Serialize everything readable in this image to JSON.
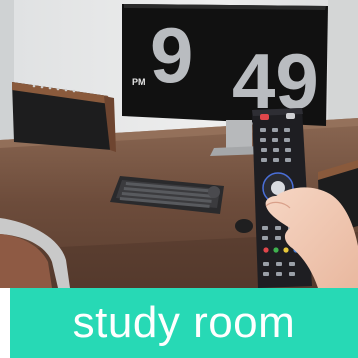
{
  "caption": "study room",
  "clock": {
    "hour": "9",
    "minute": "49",
    "period": "PM"
  },
  "colors": {
    "banner": "#27d9b5",
    "wall": "#e9eaea",
    "desk": "#7a5946",
    "screen": "#111111"
  }
}
